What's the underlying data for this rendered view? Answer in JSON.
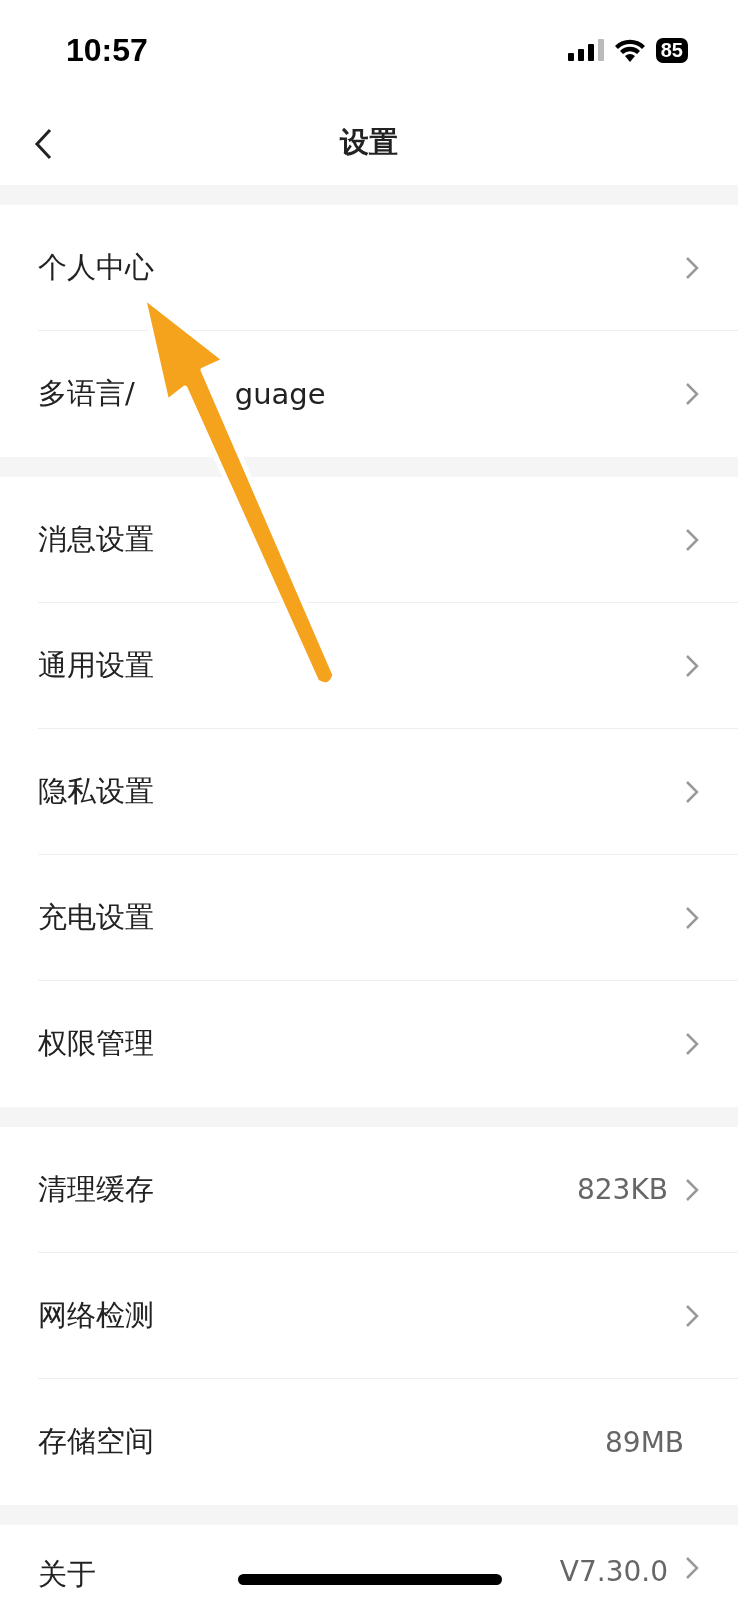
{
  "status_bar": {
    "time": "10:57",
    "battery": "85"
  },
  "nav": {
    "title": "设置"
  },
  "groups": [
    {
      "items": [
        {
          "label": "个人中心",
          "chevron": true
        },
        {
          "label": "多语言/",
          "label_tail": "guage",
          "chevron": true
        }
      ]
    },
    {
      "items": [
        {
          "label": "消息设置",
          "chevron": true
        },
        {
          "label": "通用设置",
          "chevron": true
        },
        {
          "label": "隐私设置",
          "chevron": true
        },
        {
          "label": "充电设置",
          "chevron": true
        },
        {
          "label": "权限管理",
          "chevron": true
        }
      ]
    },
    {
      "items": [
        {
          "label": "清理缓存",
          "value": "823KB",
          "chevron": true
        },
        {
          "label": "网络检测",
          "chevron": true
        },
        {
          "label": "存储空间",
          "value": "89MB",
          "chevron": false
        }
      ]
    },
    {
      "items": [
        {
          "label": "关于",
          "value": "V7.30.0",
          "chevron": true
        }
      ]
    }
  ]
}
